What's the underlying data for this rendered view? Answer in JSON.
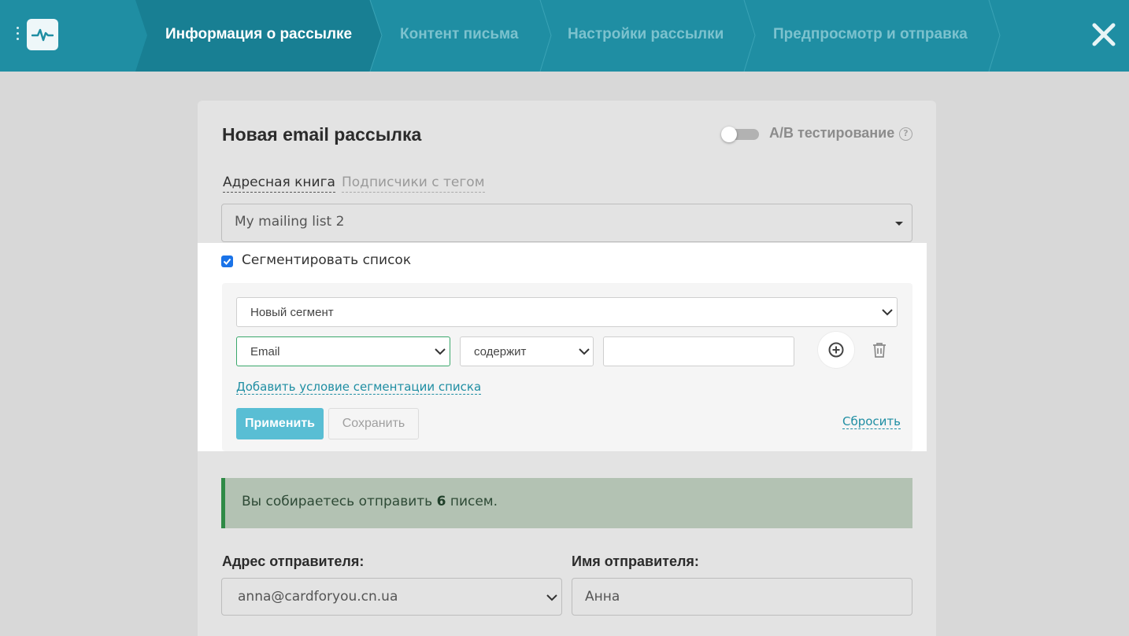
{
  "header": {
    "steps": [
      {
        "label": "Информация о рассылке",
        "active": true
      },
      {
        "label": "Контент письма",
        "active": false
      },
      {
        "label": "Настройки рассылки",
        "active": false
      },
      {
        "label": "Предпросмотр и отправка",
        "active": false
      }
    ],
    "colors": {
      "bar": "#1f8ea3",
      "active_text": "#ffffff",
      "inactive_text": "#7cc2ce"
    }
  },
  "form": {
    "title": "Новая email рассылка",
    "ab_testing": {
      "label": "A/B тестирование",
      "enabled": false,
      "help": "?"
    },
    "source_tabs": [
      {
        "label": "Адресная книга",
        "active": true
      },
      {
        "label": "Подписчики с тегом",
        "active": false
      }
    ],
    "mailing_list": "My mailing list 2",
    "segment": {
      "checkbox_label": "Сегментировать список",
      "checked": true,
      "segment_select": "Новый сегмент",
      "field_select": "Email",
      "operator_select": "содержит",
      "value": "",
      "add_condition_link": "Добавить условие сегментации списка",
      "apply_label": "Применить",
      "save_label": "Сохранить",
      "reset_label": "Сбросить"
    },
    "info": {
      "prefix": "Вы собираетесь отправить ",
      "count": "6",
      "suffix": " писем."
    },
    "sender_address": {
      "label": "Адрес отправителя:",
      "value": "anna@cardforyou.cn.ua"
    },
    "sender_name": {
      "label": "Имя отправителя:",
      "value": "Анна"
    }
  }
}
